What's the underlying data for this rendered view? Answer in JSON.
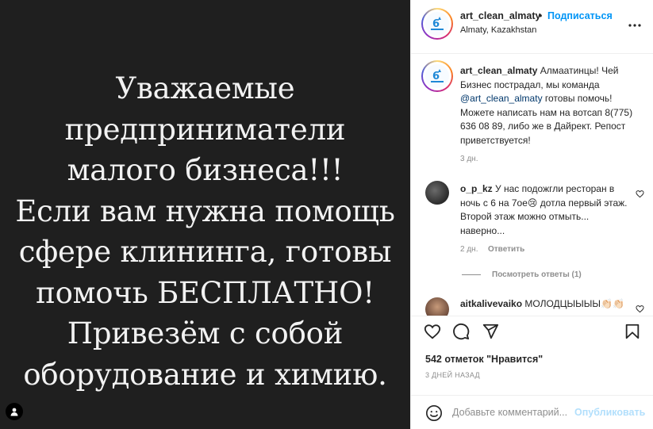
{
  "post": {
    "image_lines": [
      "Уважаемые",
      "предприниматели",
      "малого бизнеса!!!",
      "Если вам нужна помощь",
      "сфере клининга, готовы",
      "помочь БЕСПЛАТНО!",
      "Привезём с собой",
      "оборудование и химию."
    ]
  },
  "header": {
    "username": "art_clean_almaty",
    "dot": "•",
    "follow_label": "Подписаться",
    "location": "Almaty, Kazakhstan"
  },
  "caption": {
    "username": "art_clean_almaty",
    "text_1": " Алмаатинцы! Чей Бизнес пострадал, мы команда ",
    "mention": "@art_clean_almaty",
    "text_2": " готовы помочь! Можете написать нам на вотсап 8(775) 636 08 89, либо же в Дайрект. Репост приветствуется!",
    "time": "3 дн."
  },
  "comments": [
    {
      "username": "o_p_kz",
      "text": " У нас подожгли ресторан в ночь с 6 на 7ое😢 дотла первый этаж. Второй этаж можно отмыть... наверно...",
      "time": "2 дн.",
      "reply_label": "Ответить",
      "view_replies": "Посмотреть ответы (1)"
    },
    {
      "username": "aitkalivevaiko",
      "text": " МОЛОДЦЫЫЫЫ👏🏻👏🏻"
    }
  ],
  "likes_text": "542 отметок \"Нравится\"",
  "date_text": "3 ДНЕЙ НАЗАД",
  "comment_box": {
    "placeholder": "Добавьте комментарий...",
    "publish_label": "Опубликовать"
  },
  "colors": {
    "accent": "#0095f6",
    "publish_disabled": "#b2dffc",
    "media_bg": "#1f1f1f",
    "muted": "#8e8e8e"
  }
}
